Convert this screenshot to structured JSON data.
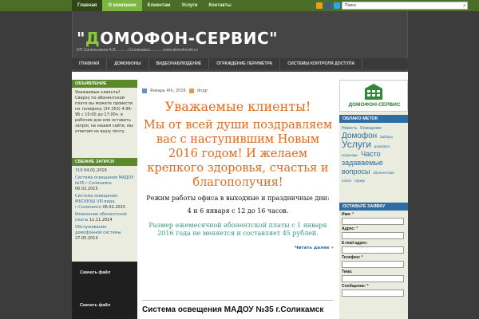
{
  "topnav": [
    "Главная",
    "О компании",
    "Клиентам",
    "Услуги",
    "Контакты"
  ],
  "search": {
    "value": "Поиск"
  },
  "site": {
    "title_q1": "\"",
    "title_d": "Д",
    "title_rest": "ОМОФОН-СЕРВИС\"",
    "description": "ИП Синельников А.В...........г.Соликамск............www.domofonslk.ru"
  },
  "mainnav": [
    "ГЛАВНАЯ",
    "ДОМОФОНЫ",
    "ВИДЕОНАБЛЮДЕНИЕ",
    "ОГРАЖДЕНИЕ ПЕРИМЕТРА",
    "СИСТЕМЫ КОНТРОЛЯ ДОСТУПА"
  ],
  "announce": {
    "title": "ОБЪЯВЛЕНИЕ",
    "text": "Уважаемые клиенты! Сверху по абонентской плате вы можете провести по телефону (34 253) 4-96-96 с 10:00 до 17:00ч. в рабочие дни или оставить запрос на нашем сайте, мы ответим на вашу почту."
  },
  "recent": {
    "title": "СВЕЖИЕ ЗАПИСИ",
    "items": [
      {
        "link": "318",
        "date": "04.01.2016"
      },
      {
        "link": "Система освещения МАДОУ №35 г.Соликамск",
        "date": "06.02.2015"
      },
      {
        "link": "Система освещения МБСКЮШ VIII вида, г.Соликамск",
        "date": "06.02.2015"
      },
      {
        "link": "Изменение абонентской платы",
        "date": "11.11.2014"
      },
      {
        "link": "Обслуживание домофонной системы",
        "date": "27.05.2014"
      }
    ]
  },
  "download": {
    "label1": "Скачать файл",
    "label2": "Скачать файл"
  },
  "post": {
    "date": "Январь 4th, 2016",
    "author": "drugr",
    "greeting1": "Уважаемые клиенты!",
    "greeting2": "Мы от всей души поздравляем вас с наступившим Новым 2016 годом! И желаем крепкого здоровья, счастья и благополучия!",
    "hours_title": "Режим работы офиса в выходные и праздничные дни:",
    "hours": "4 и 6 января с 12 до 16 часов.",
    "fee": "Размер ежемесячной абонентской платы с 1 января 2016 года не меняется и составляет 45 рублей.",
    "read_more": "Читать далее »"
  },
  "post2": {
    "title": "Система освещения МАДОУ №35 г.Соликамск"
  },
  "logo": {
    "text": "ДОМОФОН-СЕРВИС"
  },
  "tags": {
    "title": "ОБЛАКО МЕТОК",
    "items": [
      {
        "text": "Новость",
        "size": 5
      },
      {
        "text": "Освещение",
        "size": 5
      },
      {
        "text": "Домофон",
        "size": 10
      },
      {
        "text": "Заборы",
        "size": 4.5
      },
      {
        "text": "Услуги",
        "size": 12
      },
      {
        "text": "домофон",
        "size": 4.5
      },
      {
        "text": "подъезды",
        "size": 4.5
      },
      {
        "text": "Часто задаваемые вопросы",
        "size": 9
      },
      {
        "text": "абонентская плата",
        "size": 4.5
      },
      {
        "text": "тариф",
        "size": 4.5
      }
    ]
  },
  "order": {
    "title": "ОСТАВЬТЕ ЗАЯВКУ",
    "fields": [
      {
        "label": "Имя:",
        "required": true
      },
      {
        "label": "Адрес:",
        "required": true
      },
      {
        "label": "E-mail адрес:",
        "required": false
      },
      {
        "label": "Телефон:",
        "required": true
      },
      {
        "label": "Тема:",
        "required": false
      },
      {
        "label": "Сообщение:",
        "required": true
      }
    ]
  },
  "colors": {
    "green": "#7ab641",
    "blue": "#2e6da4",
    "orange": "#e06a1f",
    "teal": "#2e9a7a"
  }
}
